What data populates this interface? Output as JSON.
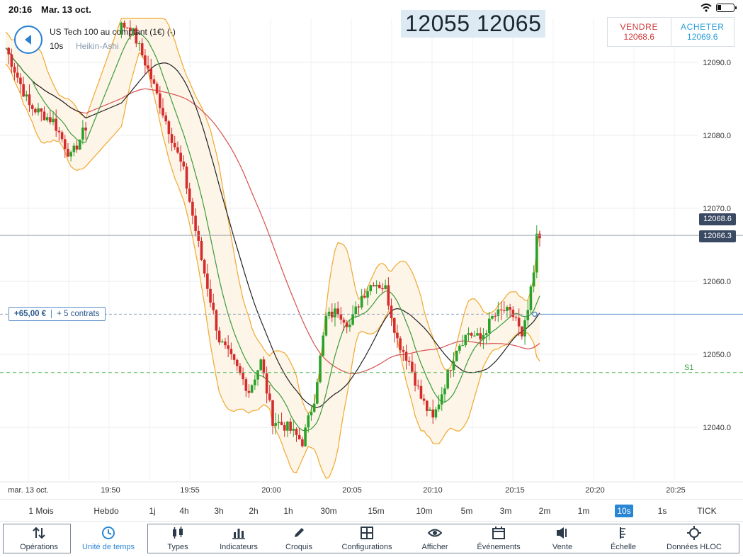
{
  "status": {
    "time": "20:16",
    "date": "Mar. 13 oct."
  },
  "instrument": {
    "name": "US Tech 100 au comptant (1€) (-)",
    "interval": "10s",
    "style": "Heikin-Ashi"
  },
  "overlay_price": "12055 12065",
  "trade": {
    "sell_label": "VENDRE",
    "sell_price": "12068.6",
    "buy_label": "ACHETER",
    "buy_price": "12069.6"
  },
  "price_tags": {
    "bid": "12068.6",
    "last": "12066.3"
  },
  "position": {
    "pnl": "+65,00 €",
    "contracts": "+ 5 contrats"
  },
  "support_label": "S1",
  "colors": {
    "up": "#2aa12a",
    "down": "#d42b2b",
    "band": "#f0a830",
    "ma_fast": "#3b9c3b",
    "ma_slow": "#d65050",
    "ma_black": "#222222",
    "accent": "#2a86d5"
  },
  "chart_data": {
    "type": "candlestick",
    "y_ticks": [
      "12090.0",
      "12080.0",
      "12070.0",
      "12060.0",
      "12050.0",
      "12040.0"
    ],
    "x_ticks": [
      "mar. 13 oct.",
      "19:50",
      "19:55",
      "20:00",
      "20:05",
      "20:10",
      "20:15",
      "20:20",
      "20:25"
    ],
    "ylim": [
      12032,
      12097
    ],
    "levels": {
      "bid": 12068.6,
      "last": 12066.3,
      "position": 12055.5,
      "support_s1": 12047.5
    },
    "price_path": [
      [
        0,
        12092
      ],
      [
        8,
        12084
      ],
      [
        16,
        12082
      ],
      [
        22,
        12077
      ],
      [
        28,
        12082
      ],
      [
        34,
        12092
      ],
      [
        39,
        12095
      ],
      [
        42,
        12095
      ],
      [
        48,
        12089
      ],
      [
        54,
        12082
      ],
      [
        60,
        12075
      ],
      [
        66,
        12063
      ],
      [
        72,
        12052
      ],
      [
        78,
        12048
      ],
      [
        82,
        12045
      ],
      [
        86,
        12049
      ],
      [
        90,
        12041
      ],
      [
        95,
        12040
      ],
      [
        100,
        12038
      ],
      [
        104,
        12044
      ],
      [
        108,
        12055
      ],
      [
        112,
        12056
      ],
      [
        116,
        12054
      ],
      [
        120,
        12058
      ],
      [
        124,
        12060
      ],
      [
        128,
        12059
      ],
      [
        132,
        12052
      ],
      [
        136,
        12049
      ],
      [
        140,
        12044
      ],
      [
        144,
        12041
      ],
      [
        148,
        12046
      ],
      [
        152,
        12051
      ],
      [
        156,
        12053
      ],
      [
        160,
        12052
      ],
      [
        164,
        12055
      ],
      [
        168,
        12056
      ],
      [
        172,
        12055
      ],
      [
        174,
        12052
      ],
      [
        176,
        12056
      ],
      [
        178,
        12061
      ],
      [
        179,
        12066
      ]
    ]
  },
  "timeframes": [
    "1 Mois",
    "Hebdo",
    "1j",
    "4h",
    "3h",
    "2h",
    "1h",
    "30m",
    "15m",
    "10m",
    "5m",
    "3m",
    "2m",
    "1m",
    "10s",
    "1s",
    "TICK"
  ],
  "active_timeframe": "10s",
  "toolbar": [
    {
      "label": "Opérations",
      "icon": "sort-arrows-icon"
    },
    {
      "label": "Unité de temps",
      "icon": "clock-icon"
    },
    {
      "label": "Types",
      "icon": "candles-icon"
    },
    {
      "label": "Indicateurs",
      "icon": "bar-chart-icon"
    },
    {
      "label": "Croquis",
      "icon": "pencil-icon"
    },
    {
      "label": "Configurations",
      "icon": "layout-icon"
    },
    {
      "label": "Afficher",
      "icon": "eye-icon"
    },
    {
      "label": "Événements",
      "icon": "calendar-icon"
    },
    {
      "label": "Vente",
      "icon": "speaker-icon"
    },
    {
      "label": "Échelle",
      "icon": "scale-icon"
    },
    {
      "label": "Données HLOC",
      "icon": "crosshair-icon"
    }
  ]
}
